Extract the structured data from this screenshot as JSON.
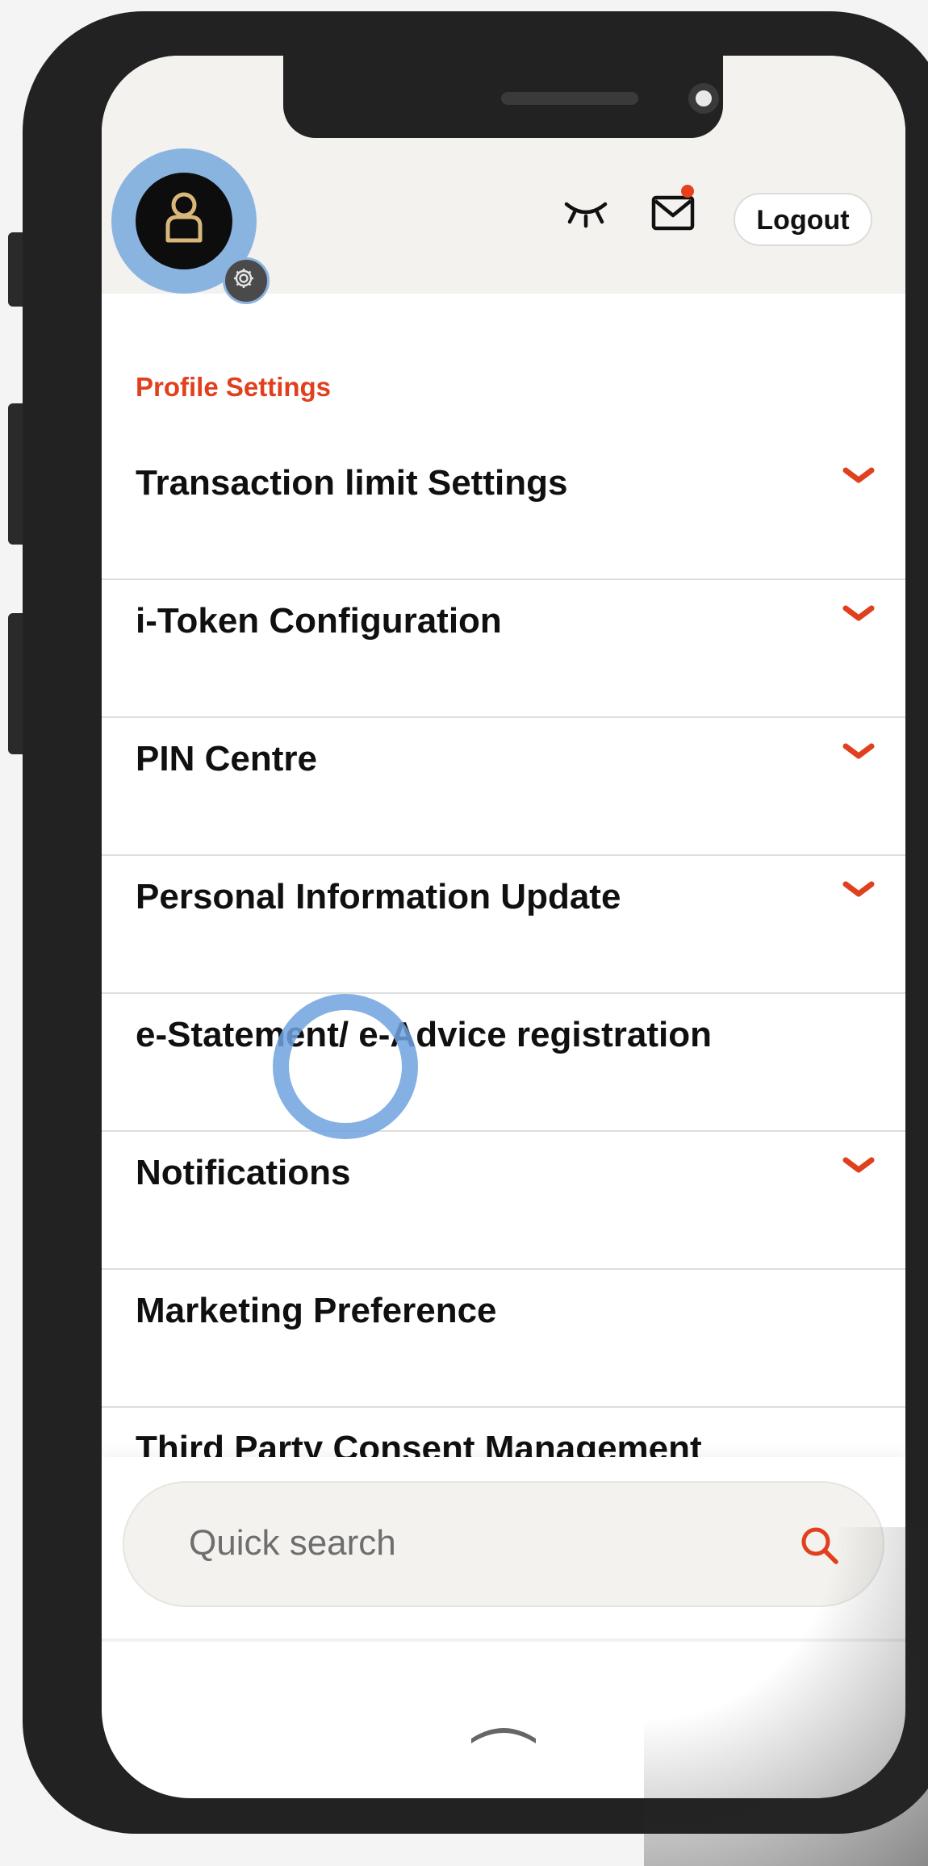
{
  "header": {
    "avatar_icon": "user-icon",
    "settings_badge_icon": "gear-icon",
    "visibility_icon": "eye-closed-icon",
    "mail_icon": "mail-icon",
    "mail_unread": true,
    "logout_label": "Logout"
  },
  "section_title": "Profile Settings",
  "menu": [
    {
      "label": "Transaction limit Settings",
      "expandable": true
    },
    {
      "label": "i-Token Configuration",
      "expandable": true
    },
    {
      "label": "PIN Centre",
      "expandable": true
    },
    {
      "label": "Personal Information Update",
      "expandable": true
    },
    {
      "label": "e-Statement/ e-Advice registration",
      "expandable": false
    },
    {
      "label": "Notifications",
      "expandable": true
    },
    {
      "label": "Marketing Preference",
      "expandable": false
    },
    {
      "label": "Third Party Consent Management",
      "expandable": false
    }
  ],
  "search": {
    "placeholder": "Quick search",
    "icon": "search-icon"
  },
  "footer": {
    "collapse_icon": "chevron-up-icon"
  },
  "colors": {
    "accent": "#e0401e",
    "header_bg": "#f3f2ee",
    "tap_indicator": "#8ab4e0"
  }
}
